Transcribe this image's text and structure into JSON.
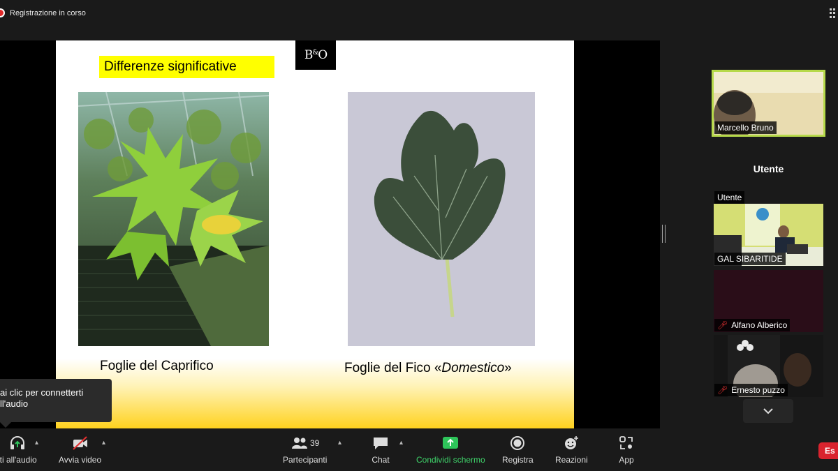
{
  "recording": {
    "label": "Registrazione in corso"
  },
  "slide": {
    "title": "Differenze significative",
    "logo": "B&O",
    "caption_left": "Foglie del  Caprifico",
    "caption_right_prefix": "Foglie del Fico «",
    "caption_right_italic": "Domestico",
    "caption_right_suffix": "»"
  },
  "participants_panel": {
    "tiles": [
      {
        "name": "Marcello Bruno",
        "muted": false
      },
      {
        "name": "Utente",
        "display_name": "Utente",
        "muted": false
      },
      {
        "name": "GAL SIBARITIDE",
        "muted": false
      },
      {
        "name": "Alfano Alberico",
        "muted": true
      },
      {
        "name": "Ernesto puzzo",
        "muted": true
      }
    ]
  },
  "tooltip": {
    "line1": "ai clic per connetterti",
    "line2": "ll'audio"
  },
  "toolbar": {
    "audio_label": "iti all'audio",
    "video_label": "Avvia video",
    "participants_label": "Partecipanti",
    "participants_count": "39",
    "chat_label": "Chat",
    "share_label": "Condividi schermo",
    "record_label": "Registra",
    "reactions_label": "Reazioni",
    "apps_label": "App",
    "end_label": "Es"
  },
  "colors": {
    "active_speaker": "#b6d94a",
    "share_green": "#2ec45a",
    "end_red": "#d9232e",
    "title_highlight": "#ffff00"
  }
}
